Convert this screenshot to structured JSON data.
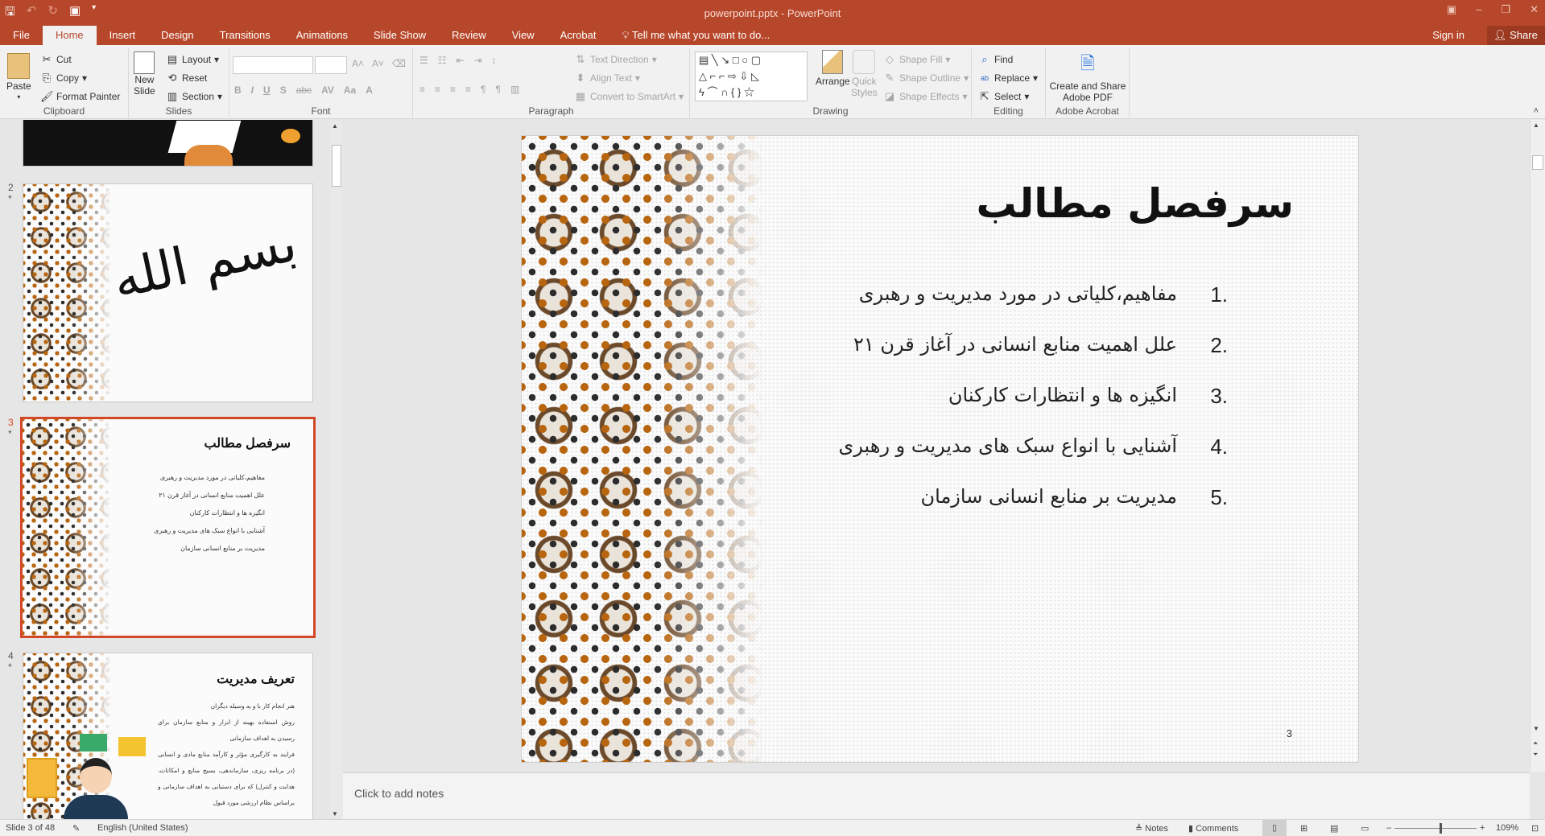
{
  "window": {
    "title": "powerpoint.pptx - PowerPoint",
    "accent": "#B7472A"
  },
  "qat": {
    "save": "save-icon",
    "undo": "undo-icon",
    "redo": "redo-icon",
    "present": "start-presentation-icon"
  },
  "tabs": [
    "File",
    "Home",
    "Insert",
    "Design",
    "Transitions",
    "Animations",
    "Slide Show",
    "Review",
    "View",
    "Acrobat"
  ],
  "active_tab": "Home",
  "tellme": "Tell me what you want to do...",
  "account": {
    "signin": "Sign in",
    "share": "Share"
  },
  "ribbon": {
    "clipboard": {
      "label": "Clipboard",
      "paste": "Paste",
      "cut": "Cut",
      "copy": "Copy",
      "format_painter": "Format Painter"
    },
    "slides": {
      "label": "Slides",
      "new_slide_1": "New",
      "new_slide_2": "Slide",
      "layout": "Layout",
      "reset": "Reset",
      "section": "Section"
    },
    "font": {
      "label": "Font",
      "font_name": "",
      "font_size": ""
    },
    "paragraph": {
      "label": "Paragraph",
      "text_direction": "Text Direction",
      "align_text": "Align Text",
      "convert_smartart": "Convert to SmartArt"
    },
    "drawing": {
      "label": "Drawing",
      "arrange": "Arrange",
      "quick_styles_1": "Quick",
      "quick_styles_2": "Styles",
      "shape_fill": "Shape Fill",
      "shape_outline": "Shape Outline",
      "shape_effects": "Shape Effects"
    },
    "editing": {
      "label": "Editing",
      "find": "Find",
      "replace": "Replace",
      "select": "Select"
    },
    "acrobat": {
      "label": "Adobe Acrobat",
      "create_1": "Create and Share",
      "create_2": "Adobe PDF"
    }
  },
  "thumbnails": [
    {
      "number": "",
      "star": ""
    },
    {
      "number": "2",
      "star": "*"
    },
    {
      "number": "3",
      "star": "*",
      "title": "سرفصل مطالب",
      "items": [
        "مفاهیم،کلیاتی در مورد مدیریت و رهبری",
        "علل اهمیت منابع انسانی در آغاز قرن ۲۱",
        "انگیزه ها و انتظارات کارکنان",
        "آشنایی با انواع سبک های مدیریت و رهبری",
        "مدیریت بر منابع انسانی سازمان"
      ]
    },
    {
      "number": "4",
      "star": "*",
      "title": "تعریف مدیریت",
      "items": [
        "هنر انجام کار با و به وسیله دیگران",
        "روش استفاده بهینه از ابزار و منابع سازمان برای رسیدن به اهداف سازمانی",
        "فرایند به کارگیری مؤثر و کارآمد منابع مادی و انسانی (در برنامه ریزی، سازماندهی، بسیج منابع و امکانات، هدایت و کنترل) که برای دستیابی به اهداف سازمانی و براساس نظام ارزشی مورد قبول"
      ]
    }
  ],
  "slide": {
    "title": "سرفصل مطالب",
    "items": [
      {
        "num": "1.",
        "text": "مفاهیم،کلیاتی در مورد مدیریت و رهبری"
      },
      {
        "num": "2.",
        "text": "علل اهمیت منابع انسانی در آغاز قرن ۲۱"
      },
      {
        "num": "3.",
        "text": "انگیزه ها و انتظارات کارکنان"
      },
      {
        "num": "4.",
        "text": "آشنایی با انواع سبک های مدیریت و رهبری"
      },
      {
        "num": "5.",
        "text": "مدیریت بر منابع انسانی سازمان"
      }
    ],
    "page_number": "3"
  },
  "notes_placeholder": "Click to add notes",
  "status": {
    "slide": "Slide 3 of 48",
    "language": "English (United States)",
    "notes": "Notes",
    "comments": "Comments",
    "zoom": "109%",
    "zoom_fraction": 0.55
  }
}
